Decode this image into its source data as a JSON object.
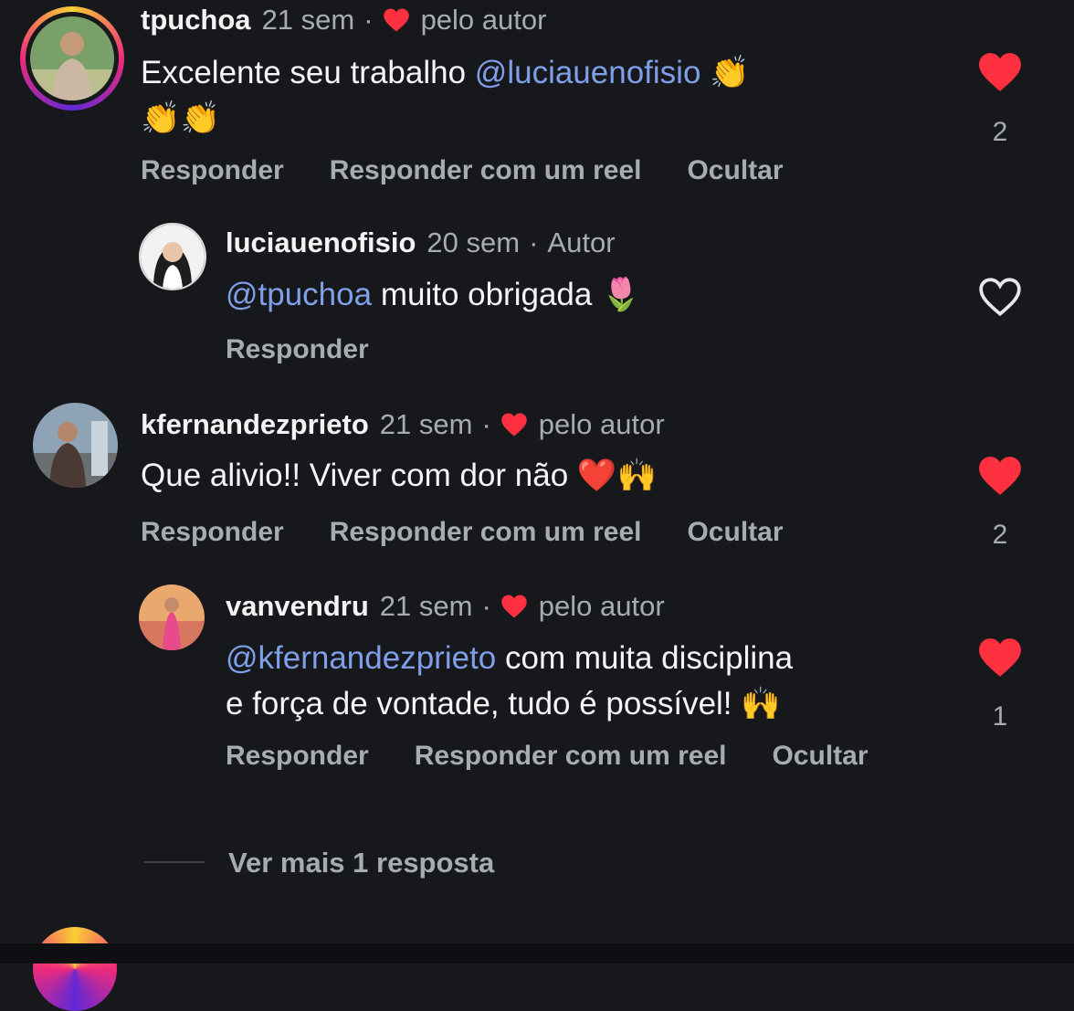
{
  "comments": [
    {
      "username": "tpuchoa",
      "time": "21 sem",
      "badge": "pelo autor",
      "text_line1": "Excelente seu trabalho ",
      "mention": "@luciauenofisio",
      "emoji_line1": "👏",
      "text_line2": "👏👏",
      "actions": [
        "Responder",
        "Responder com um reel",
        "Ocultar"
      ],
      "likes": "2",
      "liked": true
    },
    {
      "username": "luciauenofisio",
      "time": "20 sem",
      "badge": "Autor",
      "mention": "@tpuchoa",
      "text": " muito obrigada ",
      "emoji": "🌷",
      "actions": [
        "Responder"
      ],
      "liked": false
    },
    {
      "username": "kfernandezprieto",
      "time": "21 sem",
      "badge": "pelo autor",
      "text": "Que alivio!! Viver com dor não ",
      "emoji": "❤️🙌",
      "actions": [
        "Responder",
        "Responder com um reel",
        "Ocultar"
      ],
      "likes": "2",
      "liked": true
    },
    {
      "username": "vanvendru",
      "time": "21 sem",
      "badge": "pelo autor",
      "mention": "@kfernandezprieto",
      "text_line1": " com muita disciplina",
      "text_line2": "e força de vontade, tudo é possível! ",
      "emoji": "🙌",
      "actions": [
        "Responder",
        "Responder com um reel",
        "Ocultar"
      ],
      "likes": "1",
      "liked": true
    }
  ],
  "view_more": "Ver mais 1 resposta",
  "icons": {
    "heart_filled": "heart-icon",
    "heart_outline": "heart-outline-icon"
  },
  "colors": {
    "background": "#16181c",
    "like_red": "#ff3040",
    "mention_blue": "#7f9fe8",
    "muted_text": "#a7abb2"
  }
}
